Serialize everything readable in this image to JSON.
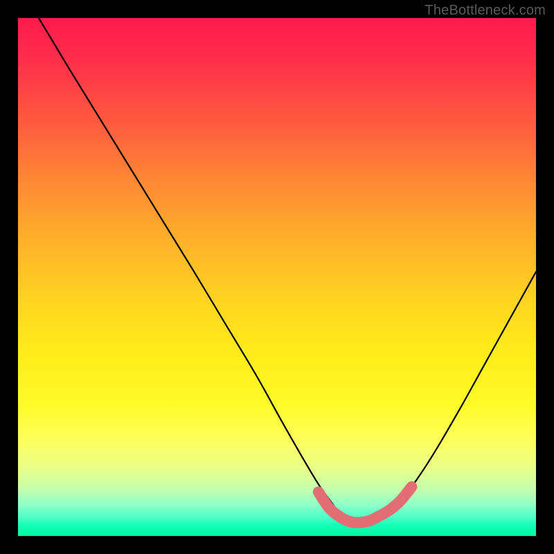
{
  "watermark": "TheBottleneck.com",
  "chart_data": {
    "type": "line",
    "title": "",
    "xlabel": "",
    "ylabel": "",
    "xlim": [
      0,
      100
    ],
    "ylim": [
      0,
      100
    ],
    "grid": false,
    "legend": false,
    "series": [
      {
        "name": "black-curve",
        "color": "#000000",
        "x": [
          4,
          10,
          18,
          26,
          34,
          40,
          46,
          51,
          55,
          58,
          60.5,
          62,
          63,
          64,
          65,
          66,
          67.5,
          69,
          71,
          73.5,
          76,
          80,
          85,
          90,
          95,
          100
        ],
        "y": [
          100,
          90,
          77,
          64,
          51,
          41,
          31,
          22,
          15,
          10,
          6.5,
          4.5,
          3.3,
          2.6,
          2.3,
          2.3,
          2.6,
          3.2,
          4.5,
          6.5,
          9.5,
          15.5,
          24,
          33,
          42,
          51
        ]
      },
      {
        "name": "pink-basin",
        "color": "#e26e73",
        "x": [
          58,
          60,
          62,
          64,
          66,
          68,
          70,
          72,
          74,
          76
        ],
        "y": [
          8.5,
          5.5,
          3.8,
          2.8,
          2.6,
          3.0,
          4.0,
          5.2,
          7.0,
          9.5
        ]
      }
    ]
  }
}
